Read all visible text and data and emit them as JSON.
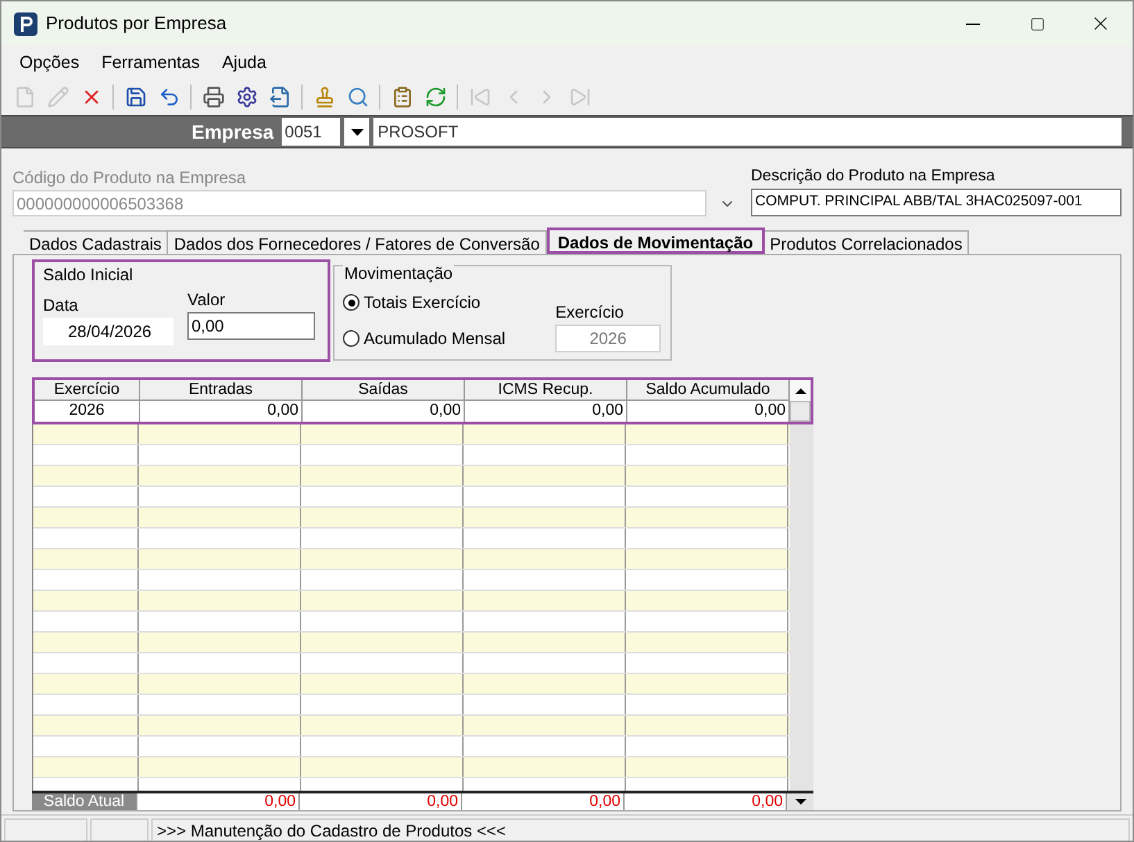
{
  "window": {
    "title": "Produtos por Empresa"
  },
  "menu": [
    "Opções",
    "Ferramentas",
    "Ajuda"
  ],
  "toolbar": [
    {
      "kind": "new",
      "disabled": true
    },
    {
      "kind": "edit",
      "disabled": true
    },
    {
      "kind": "delete",
      "disabled": false
    },
    {
      "kind": "sep"
    },
    {
      "kind": "save",
      "disabled": false
    },
    {
      "kind": "undo",
      "disabled": false
    },
    {
      "kind": "sep"
    },
    {
      "kind": "print",
      "disabled": false
    },
    {
      "kind": "print-setup",
      "disabled": false
    },
    {
      "kind": "export",
      "disabled": false
    },
    {
      "kind": "sep"
    },
    {
      "kind": "stamp",
      "disabled": false
    },
    {
      "kind": "search",
      "disabled": false
    },
    {
      "kind": "sep"
    },
    {
      "kind": "properties",
      "disabled": false
    },
    {
      "kind": "refresh",
      "disabled": false
    },
    {
      "kind": "sep"
    },
    {
      "kind": "first",
      "disabled": true
    },
    {
      "kind": "prev",
      "disabled": true
    },
    {
      "kind": "next",
      "disabled": true
    },
    {
      "kind": "last",
      "disabled": true
    }
  ],
  "empresa": {
    "label": "Empresa",
    "code": "0051",
    "name": "PROSOFT"
  },
  "produto": {
    "code_label": "Código do Produto na Empresa",
    "code": "000000000006503368",
    "desc_label": "Descrição do Produto na Empresa",
    "desc": "COMPUT. PRINCIPAL ABB/TAL 3HAC025097-001"
  },
  "tabs": [
    {
      "label": "Dados Cadastrais",
      "selected": false
    },
    {
      "label": "Dados dos Fornecedores / Fatores de Conversão",
      "selected": false
    },
    {
      "label": "Dados de Movimentação",
      "selected": true
    },
    {
      "label": "Produtos Correlacionados",
      "selected": false
    }
  ],
  "saldo_inicial": {
    "title": "Saldo Inicial",
    "data_label": "Data",
    "data": "28/04/2026",
    "valor_label": "Valor",
    "valor": "0,00"
  },
  "movimentacao": {
    "title": "Movimentação",
    "options": [
      {
        "label": "Totais Exercício",
        "selected": true
      },
      {
        "label": "Acumulado Mensal",
        "selected": false
      }
    ],
    "exercicio_label": "Exercício",
    "exercicio": "2026"
  },
  "table": {
    "columns": [
      "Exercício",
      "Entradas",
      "Saídas",
      "ICMS Recup.",
      "Saldo Acumulado"
    ],
    "rows": [
      [
        "2026",
        "0,00",
        "0,00",
        "0,00",
        "0,00"
      ]
    ],
    "footer": [
      "Saldo Atual",
      "0,00",
      "0,00",
      "0,00",
      "0,00"
    ]
  },
  "status_bar": {
    "message": ">>> Manutenção do Cadastro de Produtos <<<"
  }
}
